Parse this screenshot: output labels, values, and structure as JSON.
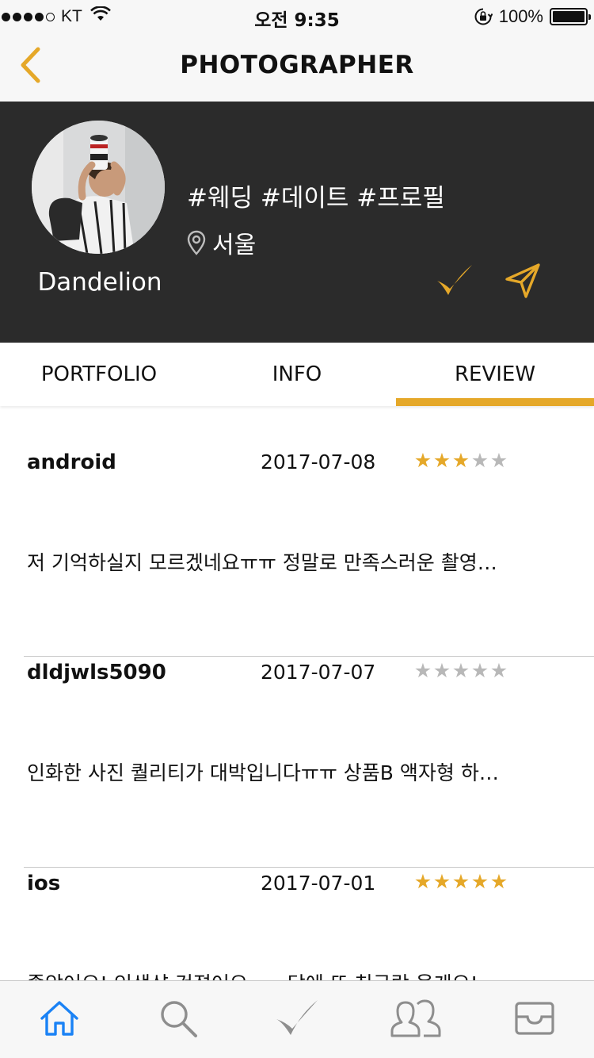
{
  "status_bar": {
    "carrier": "KT",
    "time": "오전 9:35",
    "battery": "100%",
    "battery_level": 1.0
  },
  "nav": {
    "title": "PHOTOGRAPHER",
    "back_icon": "chevron-left-icon"
  },
  "profile": {
    "name": "Dandelion",
    "tags": "#웨딩 #데이트 #프로필",
    "location": "서울",
    "location_icon": "location-pin-icon",
    "actions": [
      "checkmark-icon",
      "send-icon"
    ]
  },
  "tabs": [
    {
      "label": "PORTFOLIO",
      "active": false
    },
    {
      "label": "INFO",
      "active": false
    },
    {
      "label": "REVIEW",
      "active": true
    }
  ],
  "reviews": [
    {
      "author": "android",
      "date": "2017-07-08",
      "rating": 3,
      "text": "저 기억하실지 모르겠네요ㅠㅠ 정말로 만족스러운 촬영…"
    },
    {
      "author": "dldjwls5090",
      "date": "2017-07-07",
      "rating": 0,
      "text": "인화한 사진 퀄리티가 대박입니다ㅠㅠ 상품B 액자형 하…"
    },
    {
      "author": "ios",
      "date": "2017-07-01",
      "rating": 5,
      "text": "좋았어요! 인생샷 건졌어요~~ 담에 또 친구랑 올게요!"
    }
  ],
  "tab_bar": [
    {
      "icon": "home-icon",
      "active": true
    },
    {
      "icon": "search-icon",
      "active": false
    },
    {
      "icon": "checkmark-icon",
      "active": false
    },
    {
      "icon": "users-icon",
      "active": false
    },
    {
      "icon": "inbox-icon",
      "active": false
    }
  ],
  "colors": {
    "accent": "#e5a829",
    "header_bg": "#2b2b2b",
    "active_tab_icon": "#1a82f5",
    "inactive_icon": "#8e8e8e",
    "star_off": "#b8b8b8"
  }
}
